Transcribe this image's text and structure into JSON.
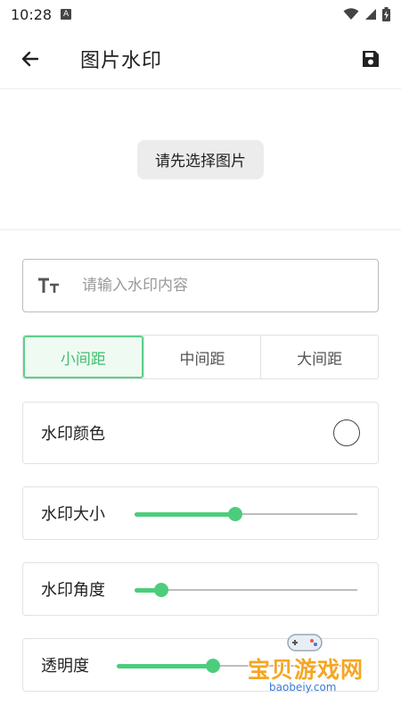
{
  "status_bar": {
    "time": "10:28",
    "notification_icon": "a-notification-icon"
  },
  "app_bar": {
    "title": "图片水印",
    "back_icon": "arrow-left-icon",
    "save_icon": "save-icon"
  },
  "preview": {
    "choose_button": "请先选择图片"
  },
  "text_input": {
    "placeholder": "请输入水印内容",
    "value": "",
    "icon": "text-size-icon"
  },
  "spacing": {
    "options": [
      "小间距",
      "中间距",
      "大间距"
    ],
    "selected": "小间距"
  },
  "settings": {
    "color_label": "水印颜色",
    "color_value": "#ffffff",
    "size_label": "水印大小",
    "size_value": 0.45,
    "angle_label": "水印角度",
    "angle_value": 0.12,
    "opacity_label": "透明度",
    "opacity_value": 0.4
  },
  "colors": {
    "accent": "#4ccd7c",
    "accent_bg": "#effaf3"
  },
  "overlay_logo": {
    "brand": "宝贝游戏网",
    "domain": "baobeiy.com"
  }
}
